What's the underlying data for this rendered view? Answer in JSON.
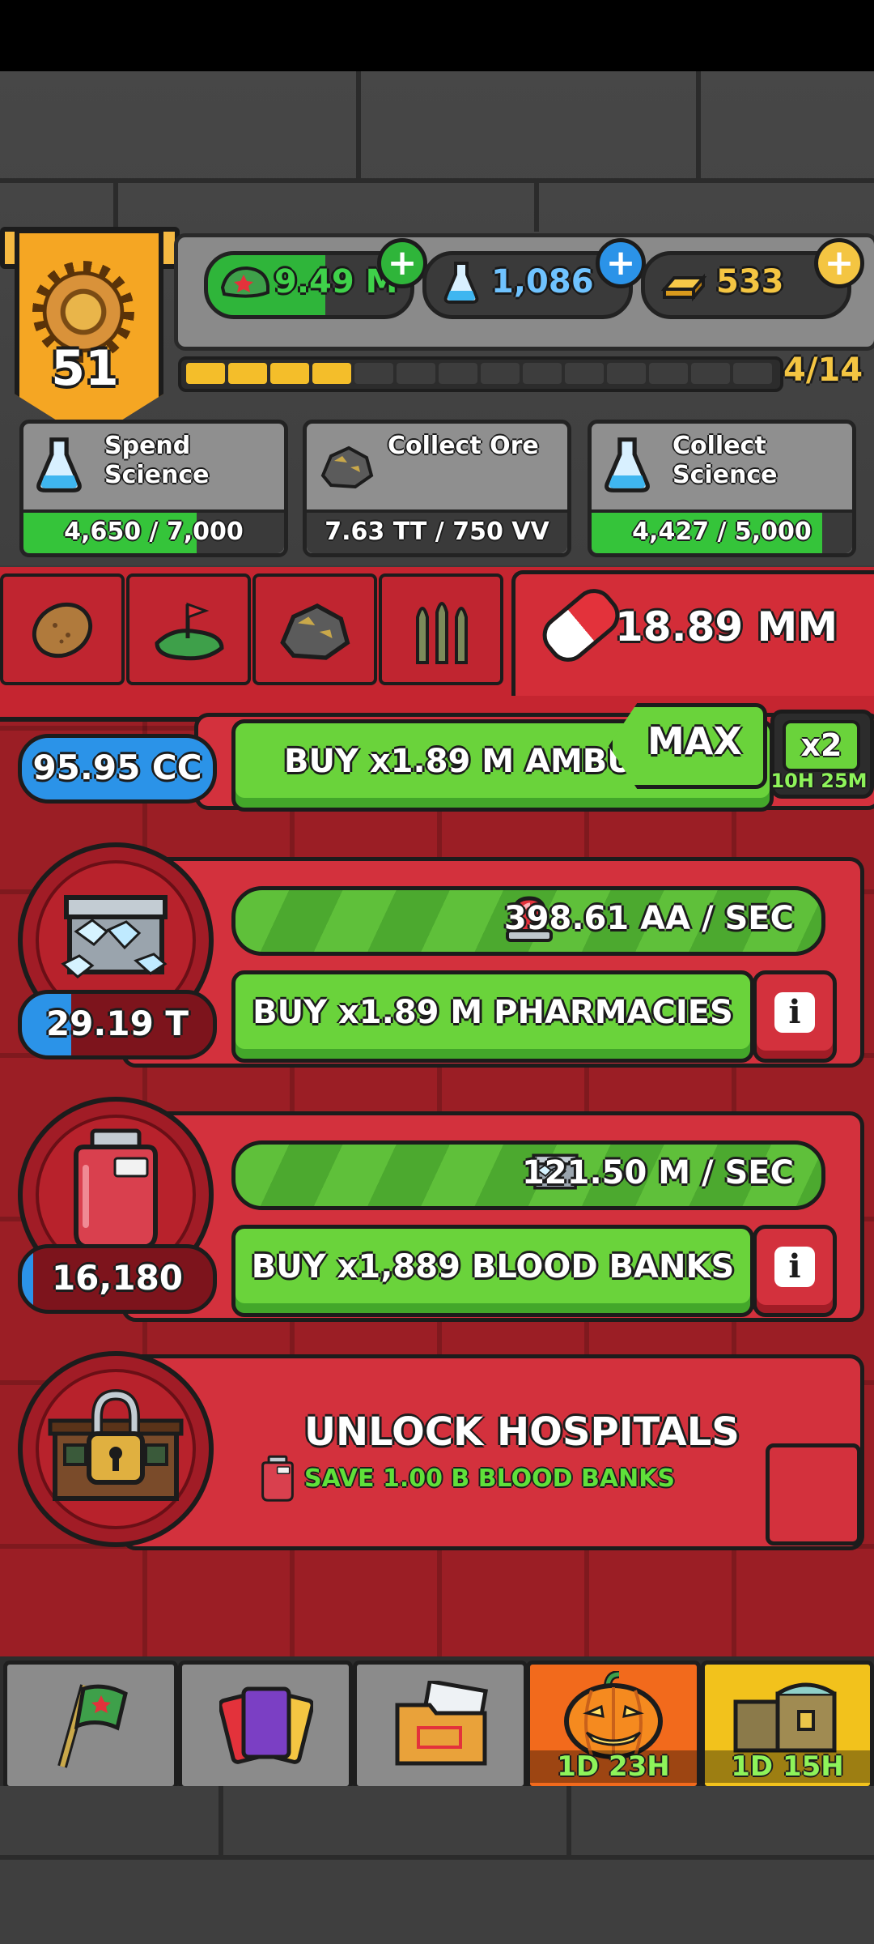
{
  "player": {
    "level": "51"
  },
  "resources": [
    {
      "name": "cash",
      "value": "9.49 M",
      "icon": "army-hat-icon",
      "color": "#3fd14a"
    },
    {
      "name": "science",
      "value": "1,086",
      "icon": "science-flask-icon",
      "color": "#6fc3ff"
    },
    {
      "name": "gold",
      "value": "533",
      "icon": "gold-bars-icon",
      "color": "#f4c542"
    }
  ],
  "progress": {
    "label": "4/14",
    "filled": 4,
    "total": 14
  },
  "quests": [
    {
      "title_line1": "Spend",
      "title_line2": "Science",
      "progress": "4,650 / 7,000",
      "fraction": 0.664,
      "icon": "science-flask-icon"
    },
    {
      "title_line1": "Collect Ore",
      "title_line2": "",
      "progress": "7.63 TT / 750 VV",
      "fraction": 0.0,
      "icon": "ore-rock-icon"
    },
    {
      "title_line1": "Collect",
      "title_line2": "Science",
      "progress": "4,427 / 5,000",
      "fraction": 0.885,
      "icon": "science-flask-icon"
    }
  ],
  "category_tabs": [
    {
      "name": "potato-icon"
    },
    {
      "name": "battlefield-flag-icon"
    },
    {
      "name": "ore-rock-icon"
    },
    {
      "name": "bullets-icon"
    }
  ],
  "active_tab": {
    "icon": "pill-icon",
    "value": "18.89 MM"
  },
  "max_button": "MAX",
  "multiplier": {
    "label": "x2",
    "timer": "10H 25M"
  },
  "rows": [
    {
      "count": "95.95 CC",
      "buy_label": "BUY x1.89 M AMBUL",
      "partial": true
    },
    {
      "count": "29.19 T",
      "count_fraction": 0.26,
      "rate": "398.61 AA / SEC",
      "rate_icon": "siren-icon",
      "buy_label": "BUY x1.89 M PHARMACIES",
      "icon": "ice-chest-icon"
    },
    {
      "count": "16,180",
      "count_fraction": 0.06,
      "rate": "121.50 M / SEC",
      "rate_icon": "ice-chest-icon",
      "buy_label": "BUY x1,889 BLOOD BANKS",
      "icon": "blood-bag-icon"
    }
  ],
  "unlock": {
    "title": "UNLOCK HOSPITALS",
    "subtitle": "SAVE 1.00 B BLOOD BANKS",
    "icon": "locked-hospital-icon"
  },
  "bottom_nav": [
    {
      "name": "flag-icon",
      "timer": ""
    },
    {
      "name": "cards-icon",
      "timer": ""
    },
    {
      "name": "folder-icon",
      "timer": ""
    },
    {
      "name": "pumpkin-event-icon",
      "timer": "1D 23H"
    },
    {
      "name": "treasure-chest-icon",
      "timer": "1D 15H"
    }
  ]
}
